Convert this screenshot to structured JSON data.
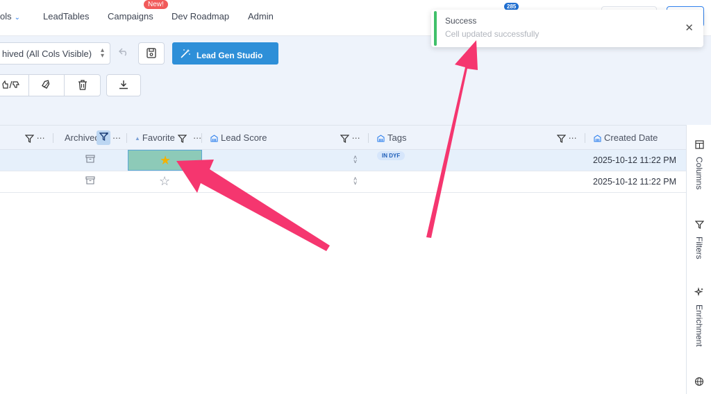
{
  "nav": {
    "items": [
      {
        "label": "ols"
      },
      {
        "label": "LeadTables"
      },
      {
        "label": "Campaigns"
      },
      {
        "label": "Dev Roadmap"
      },
      {
        "label": "Admin"
      }
    ],
    "new_badge": "New!",
    "notification_count": "285"
  },
  "toolbar": {
    "view_select": "hived (All Cols Visible)",
    "studio_button": "Lead Gen Studio"
  },
  "grid": {
    "columns": [
      {
        "label": "Archived"
      },
      {
        "label": "Favorite"
      },
      {
        "label": "Lead Score"
      },
      {
        "label": "Tags"
      },
      {
        "label": "Created Date"
      }
    ],
    "rows": [
      {
        "favorite": "★",
        "tag": "IN DYF",
        "created": "2025-10-12 11:22 PM",
        "selected": true
      },
      {
        "favorite": "☆",
        "tag": "",
        "created": "2025-10-12 11:22 PM",
        "selected": false
      }
    ]
  },
  "side_panel": {
    "tabs": [
      {
        "label": "Columns",
        "icon": "columns-icon"
      },
      {
        "label": "Filters",
        "icon": "filter-icon"
      },
      {
        "label": "Enrichment",
        "icon": "sparkle-icon"
      },
      {
        "label": "",
        "icon": "globe-icon"
      }
    ]
  },
  "toast": {
    "title": "Success",
    "message": "Cell updated successfully",
    "accent": "#3fc06a"
  },
  "colors": {
    "primary": "#2e8fd8",
    "annotation_arrow": "#f5366f",
    "selected_cell": "#8dcab8",
    "star": "#f2b100"
  }
}
